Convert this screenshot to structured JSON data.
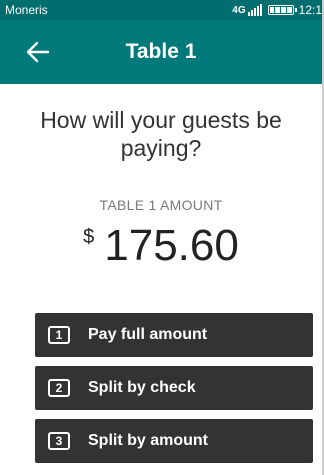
{
  "status_bar": {
    "carrier": "Moneris",
    "network": "4G",
    "time": "12:1",
    "battery_level": 1.0
  },
  "header": {
    "title": "Table 1",
    "back_icon": "arrow-left-icon"
  },
  "main": {
    "question": "How will your guests be paying?",
    "amount_label": "TABLE 1 AMOUNT",
    "currency_symbol": "$",
    "amount": "175.60"
  },
  "options": [
    {
      "number": "1",
      "label": "Pay full amount"
    },
    {
      "number": "2",
      "label": "Split by check"
    },
    {
      "number": "3",
      "label": "Split by amount"
    }
  ],
  "colors": {
    "status_bar": "#006d6f",
    "header": "#00797b",
    "button": "#333333",
    "text": "#333333",
    "muted_text": "#7a7a7a"
  }
}
